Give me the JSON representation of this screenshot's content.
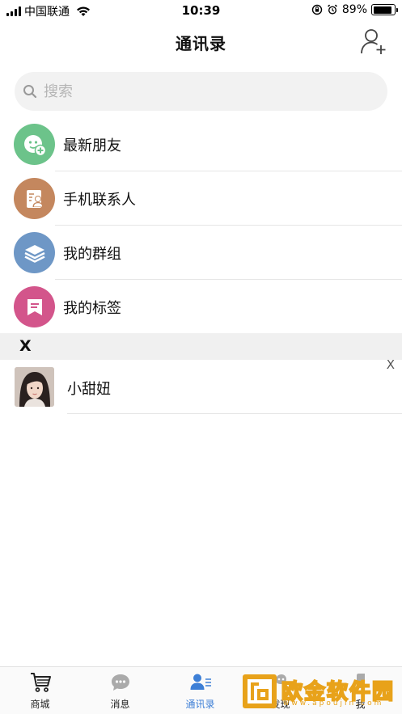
{
  "status_bar": {
    "carrier": "中国联通",
    "time": "10:39",
    "battery": "89%",
    "battery_level": 0.89
  },
  "header": {
    "title": "通讯录",
    "add_icon": "add-contact-icon"
  },
  "search": {
    "placeholder": "搜索"
  },
  "menu": [
    {
      "label": "最新朋友",
      "icon": "new-friend-icon",
      "color": "#6cc38a"
    },
    {
      "label": "手机联系人",
      "icon": "phone-contacts-icon",
      "color": "#c4875e"
    },
    {
      "label": "我的群组",
      "icon": "groups-icon",
      "color": "#6e97c6"
    },
    {
      "label": "我的标签",
      "icon": "tags-icon",
      "color": "#d3558b"
    }
  ],
  "section": {
    "letter": "X",
    "index_letter": "X"
  },
  "contacts": [
    {
      "name": "小甜妞",
      "avatar": "contact-photo"
    }
  ],
  "tabs": [
    {
      "label": "商城",
      "icon": "cart-icon",
      "active": false
    },
    {
      "label": "消息",
      "icon": "message-icon",
      "active": false
    },
    {
      "label": "通讯录",
      "icon": "contacts-icon",
      "active": true
    },
    {
      "label": "发现",
      "icon": "discover-icon",
      "active": false
    },
    {
      "label": "我",
      "icon": "me-icon",
      "active": false
    }
  ],
  "watermark": {
    "text": "欧金软件园",
    "url": "www.apoujin.com"
  },
  "colors": {
    "accent": "#3d7fd6",
    "watermark": "#e8a21a"
  }
}
